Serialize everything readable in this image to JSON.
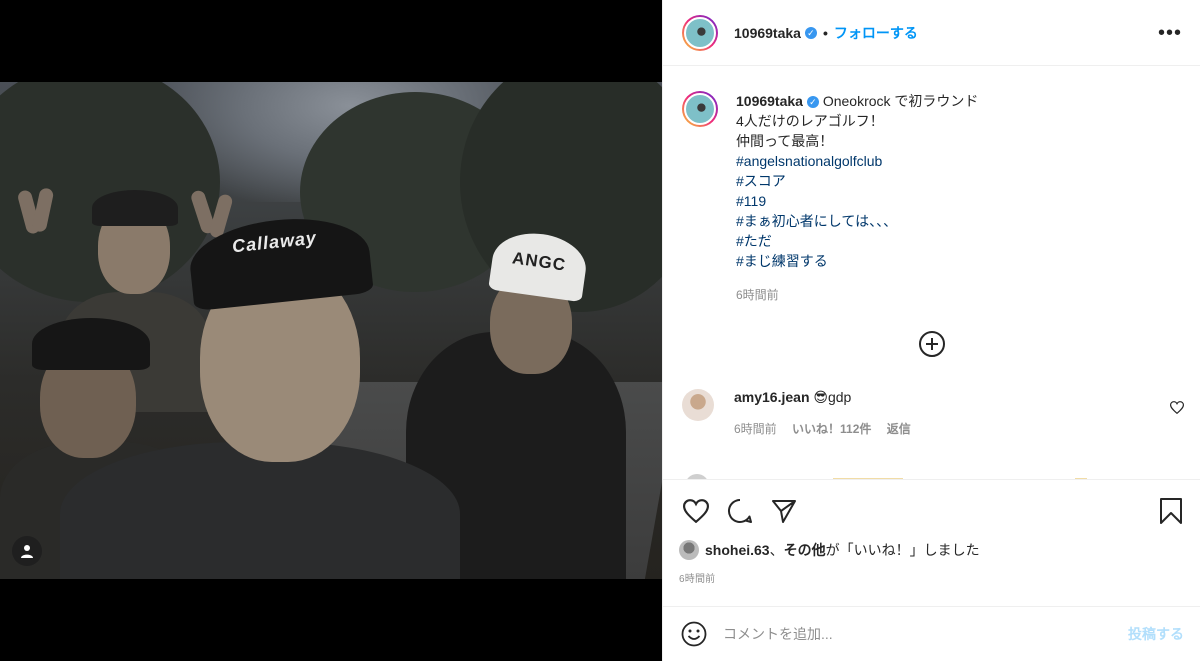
{
  "colors": {
    "link": "#0095f6",
    "hashtag": "#00376b",
    "muted": "#8e8e8e",
    "verified": "#3897f0",
    "post_disabled": "#b2dffc"
  },
  "media": {
    "cap_text_1": "Callaway",
    "cap_text_2": "ANGC",
    "tag_icon": "user-icon"
  },
  "header": {
    "username": "10969taka",
    "separator": "•",
    "follow_label": "フォローする",
    "more_icon": "more-icon",
    "more_glyph": "•••"
  },
  "caption": {
    "username": "10969taka",
    "first_line": "Oneokrock で初ラウンド",
    "lines": [
      "4人だけのレアゴルフ！",
      "仲間って最高！"
    ],
    "hashtags": [
      "#angelsnationalgolfclub",
      "#スコア",
      "#119",
      "#まぁ初心者にしては、、、",
      "#ただ",
      "#まじ練習する"
    ],
    "time": "6時間前"
  },
  "load_more_icon": "plus-circle-icon",
  "comment": {
    "username": "amy16.jean",
    "text": "😎gdp",
    "time": "6時間前",
    "likes": "いいね！112件",
    "reply": "返信"
  },
  "actions": {
    "like_icon": "heart-icon",
    "comment_icon": "comment-icon",
    "share_icon": "share-icon",
    "save_icon": "bookmark-icon"
  },
  "likes": {
    "user": "shohei.63",
    "sep": "、",
    "others": "その他",
    "suffix": "が「いいね！」しました"
  },
  "post_time": "6時間前",
  "add_comment": {
    "emoji_icon": "emoji-icon",
    "placeholder": "コメントを追加...",
    "post_label": "投稿する"
  }
}
